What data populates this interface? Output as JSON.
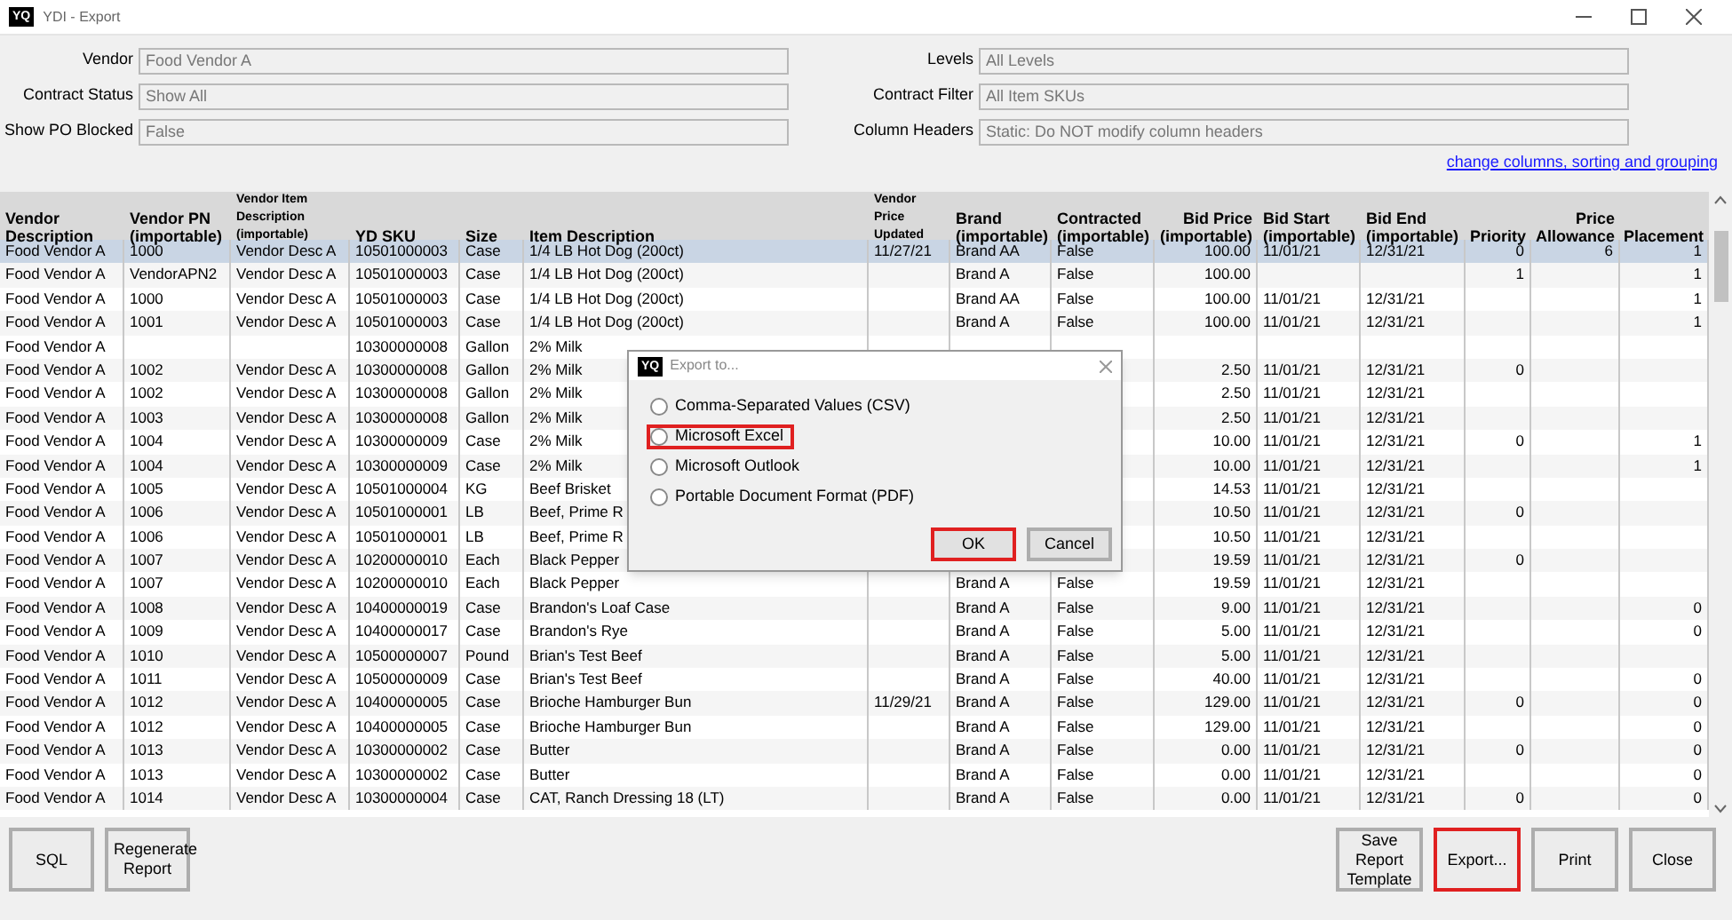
{
  "window": {
    "logo": "YQ",
    "title": "YDI - Export"
  },
  "filters_left": [
    {
      "label": "Vendor",
      "value": "Food Vendor A"
    },
    {
      "label": "Contract Status",
      "value": "Show All"
    },
    {
      "label": "Show PO Blocked",
      "value": "False"
    }
  ],
  "filters_right": [
    {
      "label": "Levels",
      "value": "All Levels"
    },
    {
      "label": "Contract Filter",
      "value": "All Item SKUs"
    },
    {
      "label": "Column Headers",
      "value": "Static:  Do NOT modify column headers"
    }
  ],
  "link": "change columns, sorting and grouping",
  "table": {
    "columns": [
      {
        "label": "Vendor Description",
        "kind": "text"
      },
      {
        "label": "Vendor PN (importable)",
        "kind": "text"
      },
      {
        "label": "Vendor Item Description (importable)",
        "kind": "small"
      },
      {
        "label": "YD SKU",
        "kind": "text"
      },
      {
        "label": "Size",
        "kind": "text"
      },
      {
        "label": "Item Description",
        "kind": "text"
      },
      {
        "label": "Vendor Price Updated",
        "kind": "small"
      },
      {
        "label": "Brand (importable)",
        "kind": "text"
      },
      {
        "label": "Contracted (importable)",
        "kind": "text"
      },
      {
        "label": "Bid Price (importable)",
        "kind": "number"
      },
      {
        "label": "Bid Start (importable)",
        "kind": "text"
      },
      {
        "label": "Bid End (importable)",
        "kind": "text"
      },
      {
        "label": "Priority",
        "kind": "number"
      },
      {
        "label": "Price Allowance",
        "kind": "number"
      },
      {
        "label": "Placement",
        "kind": "number"
      }
    ],
    "rows": [
      {
        "selected": true,
        "cells": [
          "Food Vendor A",
          "1000",
          "Vendor Desc A",
          "10501000003",
          "Case",
          "1/4 LB Hot Dog (200ct)",
          "11/27/21",
          "Brand AA",
          "False",
          "100.00",
          "11/01/21",
          "12/31/21",
          "0",
          "6",
          "1"
        ]
      },
      {
        "selected": false,
        "cells": [
          "Food Vendor A",
          "VendorAPN2",
          "Vendor Desc A",
          "10501000003",
          "Case",
          "1/4 LB Hot Dog (200ct)",
          null,
          "Brand A",
          "False",
          "100.00",
          null,
          null,
          "1",
          null,
          "1"
        ]
      },
      {
        "selected": false,
        "cells": [
          "Food Vendor A",
          "1000",
          "Vendor Desc A",
          "10501000003",
          "Case",
          "1/4 LB Hot Dog (200ct)",
          null,
          "Brand AA",
          "False",
          "100.00",
          "11/01/21",
          "12/31/21",
          null,
          null,
          "1"
        ]
      },
      {
        "selected": false,
        "cells": [
          "Food Vendor A",
          "1001",
          "Vendor Desc A",
          "10501000003",
          "Case",
          "1/4 LB Hot Dog (200ct)",
          null,
          "Brand A",
          "False",
          "100.00",
          "11/01/21",
          "12/31/21",
          null,
          null,
          "1"
        ]
      },
      {
        "selected": false,
        "cells": [
          "Food Vendor A",
          null,
          null,
          "10300000008",
          "Gallon",
          "2% Milk",
          null,
          null,
          null,
          null,
          null,
          null,
          null,
          null,
          null
        ]
      },
      {
        "selected": false,
        "cells": [
          "Food Vendor A",
          "1002",
          "Vendor Desc A",
          "10300000008",
          "Gallon",
          "2% Milk",
          null,
          null,
          null,
          "2.50",
          "11/01/21",
          "12/31/21",
          "0",
          null,
          null
        ]
      },
      {
        "selected": false,
        "cells": [
          "Food Vendor A",
          "1002",
          "Vendor Desc A",
          "10300000008",
          "Gallon",
          "2% Milk",
          null,
          null,
          null,
          "2.50",
          "11/01/21",
          "12/31/21",
          null,
          null,
          null
        ]
      },
      {
        "selected": false,
        "cells": [
          "Food Vendor A",
          "1003",
          "Vendor Desc A",
          "10300000008",
          "Gallon",
          "2% Milk",
          null,
          null,
          null,
          "2.50",
          "11/01/21",
          "12/31/21",
          null,
          null,
          null
        ]
      },
      {
        "selected": false,
        "cells": [
          "Food Vendor A",
          "1004",
          "Vendor Desc A",
          "10300000009",
          "Case",
          "2% Milk",
          null,
          null,
          null,
          "10.00",
          "11/01/21",
          "12/31/21",
          "0",
          null,
          "1"
        ]
      },
      {
        "selected": false,
        "cells": [
          "Food Vendor A",
          "1004",
          "Vendor Desc A",
          "10300000009",
          "Case",
          "2% Milk",
          null,
          null,
          null,
          "10.00",
          "11/01/21",
          "12/31/21",
          null,
          null,
          "1"
        ]
      },
      {
        "selected": false,
        "cells": [
          "Food Vendor A",
          "1005",
          "Vendor Desc A",
          "10501000004",
          "KG",
          "Beef Brisket",
          null,
          null,
          null,
          "14.53",
          "11/01/21",
          "12/31/21",
          null,
          null,
          null
        ]
      },
      {
        "selected": false,
        "cells": [
          "Food Vendor A",
          "1006",
          "Vendor Desc A",
          "10501000001",
          "LB",
          "Beef, Prime R",
          null,
          null,
          null,
          "10.50",
          "11/01/21",
          "12/31/21",
          "0",
          null,
          null
        ]
      },
      {
        "selected": false,
        "cells": [
          "Food Vendor A",
          "1006",
          "Vendor Desc A",
          "10501000001",
          "LB",
          "Beef, Prime R",
          null,
          null,
          null,
          "10.50",
          "11/01/21",
          "12/31/21",
          null,
          null,
          null
        ]
      },
      {
        "selected": false,
        "cells": [
          "Food Vendor A",
          "1007",
          "Vendor Desc A",
          "10200000010",
          "Each",
          "Black Pepper",
          null,
          null,
          null,
          "19.59",
          "11/01/21",
          "12/31/21",
          "0",
          null,
          null
        ]
      },
      {
        "selected": false,
        "cells": [
          "Food Vendor A",
          "1007",
          "Vendor Desc A",
          "10200000010",
          "Each",
          "Black Pepper",
          null,
          "Brand A",
          "False",
          "19.59",
          "11/01/21",
          "12/31/21",
          null,
          null,
          null
        ]
      },
      {
        "selected": false,
        "cells": [
          "Food Vendor A",
          "1008",
          "Vendor Desc A",
          "10400000019",
          "Case",
          "Brandon's Loaf Case",
          null,
          "Brand A",
          "False",
          "9.00",
          "11/01/21",
          "12/31/21",
          null,
          null,
          "0"
        ]
      },
      {
        "selected": false,
        "cells": [
          "Food Vendor A",
          "1009",
          "Vendor Desc A",
          "10400000017",
          "Case",
          "Brandon's Rye",
          null,
          "Brand A",
          "False",
          "5.00",
          "11/01/21",
          "12/31/21",
          null,
          null,
          "0"
        ]
      },
      {
        "selected": false,
        "cells": [
          "Food Vendor A",
          "1010",
          "Vendor Desc A",
          "10500000007",
          "Pound",
          "Brian's Test Beef",
          null,
          "Brand A",
          "False",
          "5.00",
          "11/01/21",
          "12/31/21",
          null,
          null,
          null
        ]
      },
      {
        "selected": false,
        "cells": [
          "Food Vendor A",
          "1011",
          "Vendor Desc A",
          "10500000009",
          "Case",
          "Brian's Test Beef",
          null,
          "Brand A",
          "False",
          "40.00",
          "11/01/21",
          "12/31/21",
          null,
          null,
          "0"
        ]
      },
      {
        "selected": false,
        "cells": [
          "Food Vendor A",
          "1012",
          "Vendor Desc A",
          "10400000005",
          "Case",
          "Brioche Hamburger Bun",
          "11/29/21",
          "Brand A",
          "False",
          "129.00",
          "11/01/21",
          "12/31/21",
          "0",
          null,
          "0"
        ]
      },
      {
        "selected": false,
        "cells": [
          "Food Vendor A",
          "1012",
          "Vendor Desc A",
          "10400000005",
          "Case",
          "Brioche Hamburger Bun",
          null,
          "Brand A",
          "False",
          "129.00",
          "11/01/21",
          "12/31/21",
          null,
          null,
          "0"
        ]
      },
      {
        "selected": false,
        "cells": [
          "Food Vendor A",
          "1013",
          "Vendor Desc A",
          "10300000002",
          "Case",
          "Butter",
          null,
          "Brand A",
          "False",
          "0.00",
          "11/01/21",
          "12/31/21",
          "0",
          null,
          "0"
        ]
      },
      {
        "selected": false,
        "cells": [
          "Food Vendor A",
          "1013",
          "Vendor Desc A",
          "10300000002",
          "Case",
          "Butter",
          null,
          "Brand A",
          "False",
          "0.00",
          "11/01/21",
          "12/31/21",
          null,
          null,
          "0"
        ]
      },
      {
        "selected": false,
        "cells": [
          "Food Vendor A",
          "1014",
          "Vendor Desc A",
          "10300000004",
          "Case",
          "CAT, Ranch Dressing 18 (LT)",
          null,
          "Brand A",
          "False",
          "0.00",
          "11/01/21",
          "12/31/21",
          "0",
          null,
          "0"
        ]
      }
    ]
  },
  "buttons_left": [
    {
      "label": "SQL",
      "highlighted": false
    },
    {
      "label": "Regenerate Report",
      "highlighted": false
    }
  ],
  "buttons_right": [
    {
      "label": "Save Report Template",
      "highlighted": false
    },
    {
      "label": "Export...",
      "highlighted": true
    },
    {
      "label": "Print",
      "highlighted": false
    },
    {
      "label": "Close",
      "highlighted": false
    }
  ],
  "dialog": {
    "logo": "YQ",
    "title": "Export to...",
    "options": [
      {
        "label": "Comma-Separated Values (CSV)",
        "selected": false,
        "highlighted": false
      },
      {
        "label": "Microsoft Excel",
        "selected": false,
        "highlighted": true
      },
      {
        "label": "Microsoft Outlook",
        "selected": false,
        "highlighted": false
      },
      {
        "label": "Portable Document Format (PDF)",
        "selected": false,
        "highlighted": false
      }
    ],
    "buttons": [
      {
        "label": "OK",
        "highlighted": true
      },
      {
        "label": "Cancel",
        "highlighted": false
      }
    ]
  }
}
